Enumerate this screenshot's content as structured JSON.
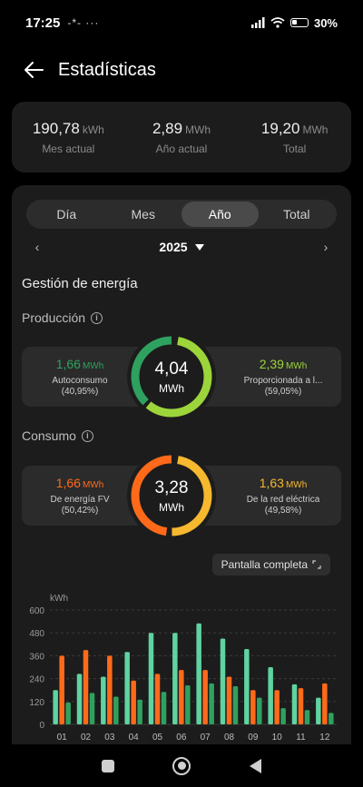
{
  "status": {
    "time": "17:25",
    "extra": "-*- ···",
    "battery": "30%"
  },
  "header": {
    "title": "Estadísticas"
  },
  "summary": [
    {
      "value": "190,78",
      "unit": "kWh",
      "label": "Mes actual"
    },
    {
      "value": "2,89",
      "unit": "MWh",
      "label": "Año actual"
    },
    {
      "value": "19,20",
      "unit": "MWh",
      "label": "Total"
    }
  ],
  "tabs": [
    "Día",
    "Mes",
    "Año",
    "Total"
  ],
  "active_tab": "Año",
  "period": {
    "year": "2025",
    "prev": "‹",
    "next": "›"
  },
  "section_title": "Gestión de energía",
  "production": {
    "label": "Producción",
    "left": {
      "value": "1,66",
      "unit": "MWh",
      "label": "Autoconsumo",
      "pct": "(40,95%)",
      "color": "#2fa15f"
    },
    "right": {
      "value": "2,39",
      "unit": "MWh",
      "label": "Proporcionada a l...",
      "pct": "(59,05%)",
      "color": "#9cd53a"
    },
    "total": "4,04",
    "unit": "MWh"
  },
  "consumption": {
    "label": "Consumo",
    "left": {
      "value": "1,66",
      "unit": "MWh",
      "label": "De energía FV",
      "pct": "(50,42%)",
      "color": "#ff6a1a"
    },
    "right": {
      "value": "1,63",
      "unit": "MWh",
      "label": "De la red eléctrica",
      "pct": "(49,58%)",
      "color": "#f5b82e"
    },
    "total": "3,28",
    "unit": "MWh"
  },
  "fullscreen_label": "Pantalla completa",
  "chart_data": {
    "type": "bar",
    "ylabel": "kWh",
    "ylim": [
      0,
      600
    ],
    "yticks": [
      "0",
      "120",
      "240",
      "360",
      "480",
      "600"
    ],
    "categories": [
      "01",
      "02",
      "03",
      "04",
      "05",
      "06",
      "07",
      "08",
      "09",
      "10",
      "11",
      "12"
    ],
    "series": [
      {
        "color": "#5fd3a0",
        "values": [
          180,
          265,
          250,
          380,
          480,
          480,
          530,
          450,
          395,
          300,
          210,
          140
        ]
      },
      {
        "color": "#ff6a1a",
        "values": [
          360,
          390,
          360,
          230,
          265,
          285,
          285,
          250,
          180,
          180,
          190,
          215
        ]
      },
      {
        "color": "#2fa15f",
        "values": [
          115,
          165,
          145,
          130,
          170,
          205,
          215,
          200,
          140,
          85,
          75,
          60
        ]
      }
    ],
    "grid": true
  }
}
